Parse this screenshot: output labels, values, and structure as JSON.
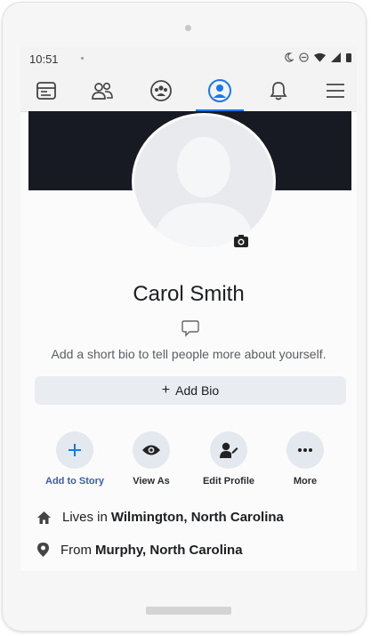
{
  "status": {
    "time": "10:51"
  },
  "profile": {
    "name": "Carol Smith",
    "bio_prompt": "Add a short bio to tell people more about yourself.",
    "add_bio_label": "Add Bio",
    "add_bio_plus": "+"
  },
  "actions": [
    {
      "label": "Add to Story",
      "icon": "plus-icon"
    },
    {
      "label": "View As",
      "icon": "eye-icon"
    },
    {
      "label": "Edit Profile",
      "icon": "edit-profile-icon"
    },
    {
      "label": "More",
      "icon": "more-icon"
    }
  ],
  "info": {
    "lives_prefix": "Lives in",
    "lives_place": "Wilmington, North Carolina",
    "from_prefix": "From",
    "from_place": "Murphy, North Carolina"
  },
  "colors": {
    "accent": "#1877f2",
    "cover": "#171a22"
  }
}
